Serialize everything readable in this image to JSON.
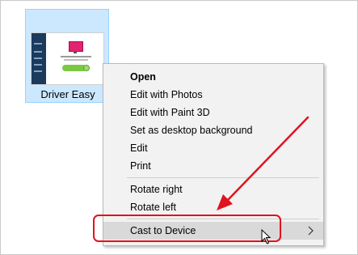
{
  "desktop": {
    "icon_label": "Driver Easy",
    "icon_name": "driver-easy-file-icon"
  },
  "context_menu": {
    "items": [
      {
        "label": "Open",
        "bold": true
      },
      {
        "label": "Edit with Photos"
      },
      {
        "label": "Edit with Paint 3D"
      },
      {
        "label": "Set as desktop background"
      },
      {
        "label": "Edit"
      },
      {
        "label": "Print"
      },
      {
        "label": "Rotate right"
      },
      {
        "label": "Rotate left"
      },
      {
        "label": "Cast to Device",
        "submenu": true,
        "hovered": true
      }
    ]
  },
  "annotation": {
    "color": "#e0141e",
    "target": "Cast to Device"
  }
}
